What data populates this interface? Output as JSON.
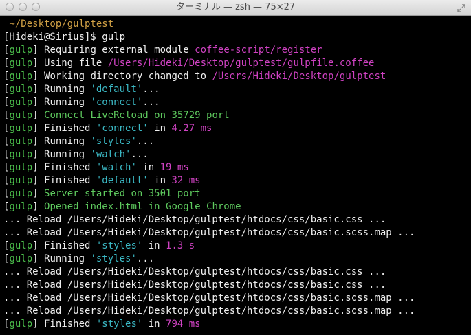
{
  "window": {
    "title": "ターミナル — zsh — 75×27"
  },
  "colors": {
    "gulp": "#4dc24d",
    "magenta": "#cf42c2",
    "cyan": "#3bb8c4",
    "orange": "#d0a045",
    "green": "#5ec95e",
    "white": "#ededed"
  },
  "lines": [
    [
      {
        "t": " ~/Desktop/gulptest",
        "c": "orange"
      }
    ],
    [
      {
        "t": "[Hideki@Sirius]$ gulp",
        "c": "white"
      }
    ],
    [
      {
        "t": "[",
        "c": "white"
      },
      {
        "t": "gulp",
        "c": "gulp"
      },
      {
        "t": "] Requiring external module ",
        "c": "white"
      },
      {
        "t": "coffee-script/register",
        "c": "mag"
      }
    ],
    [
      {
        "t": "[",
        "c": "white"
      },
      {
        "t": "gulp",
        "c": "gulp"
      },
      {
        "t": "] Using file ",
        "c": "white"
      },
      {
        "t": "/Users/Hideki/Desktop/gulptest/gulpfile.coffee",
        "c": "mag"
      }
    ],
    [
      {
        "t": "[",
        "c": "white"
      },
      {
        "t": "gulp",
        "c": "gulp"
      },
      {
        "t": "] Working directory changed to ",
        "c": "white"
      },
      {
        "t": "/Users/Hideki/Desktop/gulptest",
        "c": "mag"
      }
    ],
    [
      {
        "t": "[",
        "c": "white"
      },
      {
        "t": "gulp",
        "c": "gulp"
      },
      {
        "t": "] Running ",
        "c": "white"
      },
      {
        "t": "'default'",
        "c": "cyan"
      },
      {
        "t": "...",
        "c": "white"
      }
    ],
    [
      {
        "t": "[",
        "c": "white"
      },
      {
        "t": "gulp",
        "c": "gulp"
      },
      {
        "t": "] Running ",
        "c": "white"
      },
      {
        "t": "'connect'",
        "c": "cyan"
      },
      {
        "t": "...",
        "c": "white"
      }
    ],
    [
      {
        "t": "[",
        "c": "white"
      },
      {
        "t": "gulp",
        "c": "gulp"
      },
      {
        "t": "] ",
        "c": "white"
      },
      {
        "t": "Connect LiveReload on 35729 port",
        "c": "green"
      }
    ],
    [
      {
        "t": "[",
        "c": "white"
      },
      {
        "t": "gulp",
        "c": "gulp"
      },
      {
        "t": "] Finished ",
        "c": "white"
      },
      {
        "t": "'connect'",
        "c": "cyan"
      },
      {
        "t": " in ",
        "c": "white"
      },
      {
        "t": "4.27 ms",
        "c": "mag"
      }
    ],
    [
      {
        "t": "[",
        "c": "white"
      },
      {
        "t": "gulp",
        "c": "gulp"
      },
      {
        "t": "] Running ",
        "c": "white"
      },
      {
        "t": "'styles'",
        "c": "cyan"
      },
      {
        "t": "...",
        "c": "white"
      }
    ],
    [
      {
        "t": "[",
        "c": "white"
      },
      {
        "t": "gulp",
        "c": "gulp"
      },
      {
        "t": "] Running ",
        "c": "white"
      },
      {
        "t": "'watch'",
        "c": "cyan"
      },
      {
        "t": "...",
        "c": "white"
      }
    ],
    [
      {
        "t": "[",
        "c": "white"
      },
      {
        "t": "gulp",
        "c": "gulp"
      },
      {
        "t": "] Finished ",
        "c": "white"
      },
      {
        "t": "'watch'",
        "c": "cyan"
      },
      {
        "t": " in ",
        "c": "white"
      },
      {
        "t": "19 ms",
        "c": "mag"
      }
    ],
    [
      {
        "t": "[",
        "c": "white"
      },
      {
        "t": "gulp",
        "c": "gulp"
      },
      {
        "t": "] Finished ",
        "c": "white"
      },
      {
        "t": "'default'",
        "c": "cyan"
      },
      {
        "t": " in ",
        "c": "white"
      },
      {
        "t": "32 ms",
        "c": "mag"
      }
    ],
    [
      {
        "t": "[",
        "c": "white"
      },
      {
        "t": "gulp",
        "c": "gulp"
      },
      {
        "t": "] ",
        "c": "white"
      },
      {
        "t": "Server started on 3501 port",
        "c": "green"
      }
    ],
    [
      {
        "t": "[",
        "c": "white"
      },
      {
        "t": "gulp",
        "c": "gulp"
      },
      {
        "t": "] ",
        "c": "white"
      },
      {
        "t": "Opened index.html in Google Chrome",
        "c": "green"
      }
    ],
    [
      {
        "t": "... Reload /Users/Hideki/Desktop/gulptest/htdocs/css/basic.css ...",
        "c": "white"
      }
    ],
    [
      {
        "t": "... Reload /Users/Hideki/Desktop/gulptest/htdocs/css/basic.scss.map ...",
        "c": "white"
      }
    ],
    [
      {
        "t": "[",
        "c": "white"
      },
      {
        "t": "gulp",
        "c": "gulp"
      },
      {
        "t": "] Finished ",
        "c": "white"
      },
      {
        "t": "'styles'",
        "c": "cyan"
      },
      {
        "t": " in ",
        "c": "white"
      },
      {
        "t": "1.3 s",
        "c": "mag"
      }
    ],
    [
      {
        "t": "[",
        "c": "white"
      },
      {
        "t": "gulp",
        "c": "gulp"
      },
      {
        "t": "] Running ",
        "c": "white"
      },
      {
        "t": "'styles'",
        "c": "cyan"
      },
      {
        "t": "...",
        "c": "white"
      }
    ],
    [
      {
        "t": "... Reload /Users/Hideki/Desktop/gulptest/htdocs/css/basic.css ...",
        "c": "white"
      }
    ],
    [
      {
        "t": "... Reload /Users/Hideki/Desktop/gulptest/htdocs/css/basic.css ...",
        "c": "white"
      }
    ],
    [
      {
        "t": "... Reload /Users/Hideki/Desktop/gulptest/htdocs/css/basic.scss.map ...",
        "c": "white"
      }
    ],
    [
      {
        "t": "... Reload /Users/Hideki/Desktop/gulptest/htdocs/css/basic.scss.map ...",
        "c": "white"
      }
    ],
    [
      {
        "t": "[",
        "c": "white"
      },
      {
        "t": "gulp",
        "c": "gulp"
      },
      {
        "t": "] Finished ",
        "c": "white"
      },
      {
        "t": "'styles'",
        "c": "cyan"
      },
      {
        "t": " in ",
        "c": "white"
      },
      {
        "t": "794 ms",
        "c": "mag"
      }
    ]
  ]
}
